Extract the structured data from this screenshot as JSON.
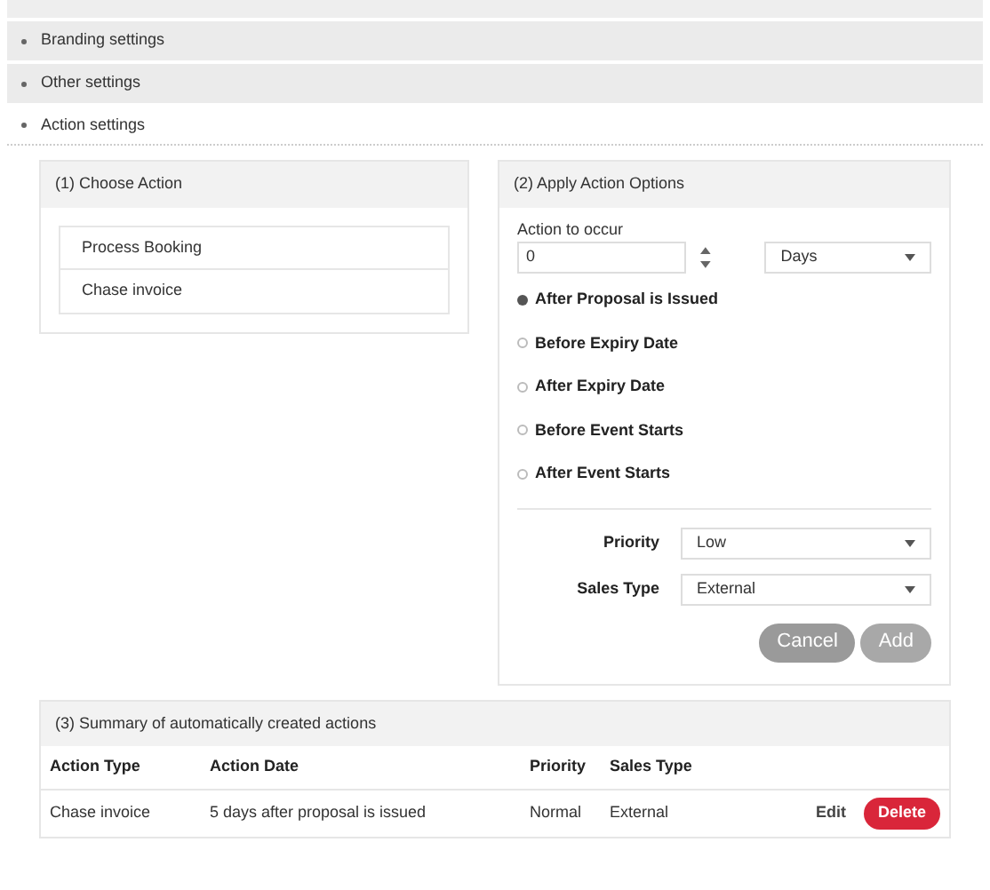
{
  "accordion": [
    {
      "label": "Branding settings",
      "expanded": false
    },
    {
      "label": "Other settings",
      "expanded": false
    },
    {
      "label": "Action settings",
      "expanded": true
    }
  ],
  "choose_action": {
    "title": "(1) Choose Action",
    "items": [
      {
        "label": "Process Booking",
        "selected": false
      },
      {
        "label": "Chase invoice",
        "selected": false
      }
    ]
  },
  "apply_options": {
    "title": "(2) Apply Action Options",
    "occur_label": "Action to occur",
    "occur_value": "0",
    "unit_value": "Days",
    "timing": [
      {
        "label": "After Proposal is Issued",
        "selected": true
      },
      {
        "label": "Before Expiry Date",
        "selected": false
      },
      {
        "label": "After Expiry Date",
        "selected": false
      },
      {
        "label": "Before Event Starts",
        "selected": false
      },
      {
        "label": "After Event Starts",
        "selected": false
      }
    ],
    "fields": [
      {
        "label": "Priority",
        "value": "Low"
      },
      {
        "label": "Sales Type",
        "value": "External"
      }
    ],
    "buttons": [
      {
        "label": "Cancel",
        "disabled": true
      },
      {
        "label": "Add",
        "disabled": true
      }
    ]
  },
  "summary": {
    "title": "(3) Summary of automatically created actions",
    "columns": [
      "Action Type",
      "Action Date",
      "Priority",
      "Sales Type"
    ],
    "rows": [
      {
        "cells": [
          "Chase invoice",
          "5 days after proposal is issued",
          "Normal",
          "External"
        ],
        "edit": "Edit",
        "delete": "Delete"
      }
    ]
  }
}
